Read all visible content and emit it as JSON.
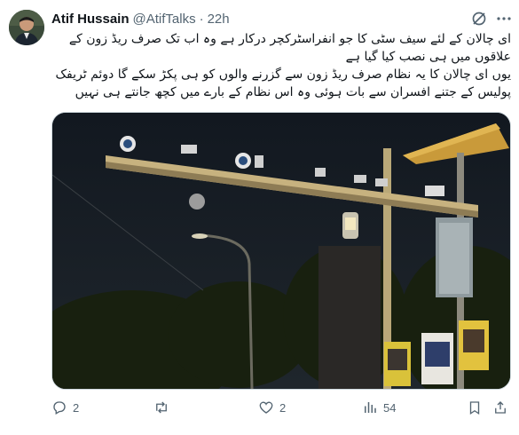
{
  "tweet": {
    "author_name": "Atif Hussain",
    "author_handle": "@AtifTalks",
    "separator": "·",
    "time": "22h",
    "text_lines": [
      "ای چالان کے لئے سیف سٹی کا جو انفراسٹرکچر درکار ہے وہ اب تک صرف ریڈ زون کے",
      "علاقوں میں ہی نصب کیا گیا ہے",
      "یوں ای چالان کا یہ نظام صرف ریڈ زون سے گزرنے والوں کو ہی پکڑ سکے گا دوئم ٹریفک",
      "پولیس کے جتنے افسران سے بات ہوئی وہ اس نظام کے بارے میں کچھ جانتے ہی نہیں"
    ],
    "replies": "2",
    "retweets": "",
    "likes": "2",
    "views": "54"
  },
  "icons": {
    "avatar": "avatar-photo",
    "grok": "grok-icon",
    "more": "more-icon",
    "reply": "reply-icon",
    "retweet": "retweet-icon",
    "like": "heart-icon",
    "views": "views-icon",
    "bookmark": "bookmark-icon",
    "share": "share-icon"
  },
  "colors": {
    "text": "#0f1419",
    "secondary": "#536471",
    "border": "#cfd9de"
  }
}
